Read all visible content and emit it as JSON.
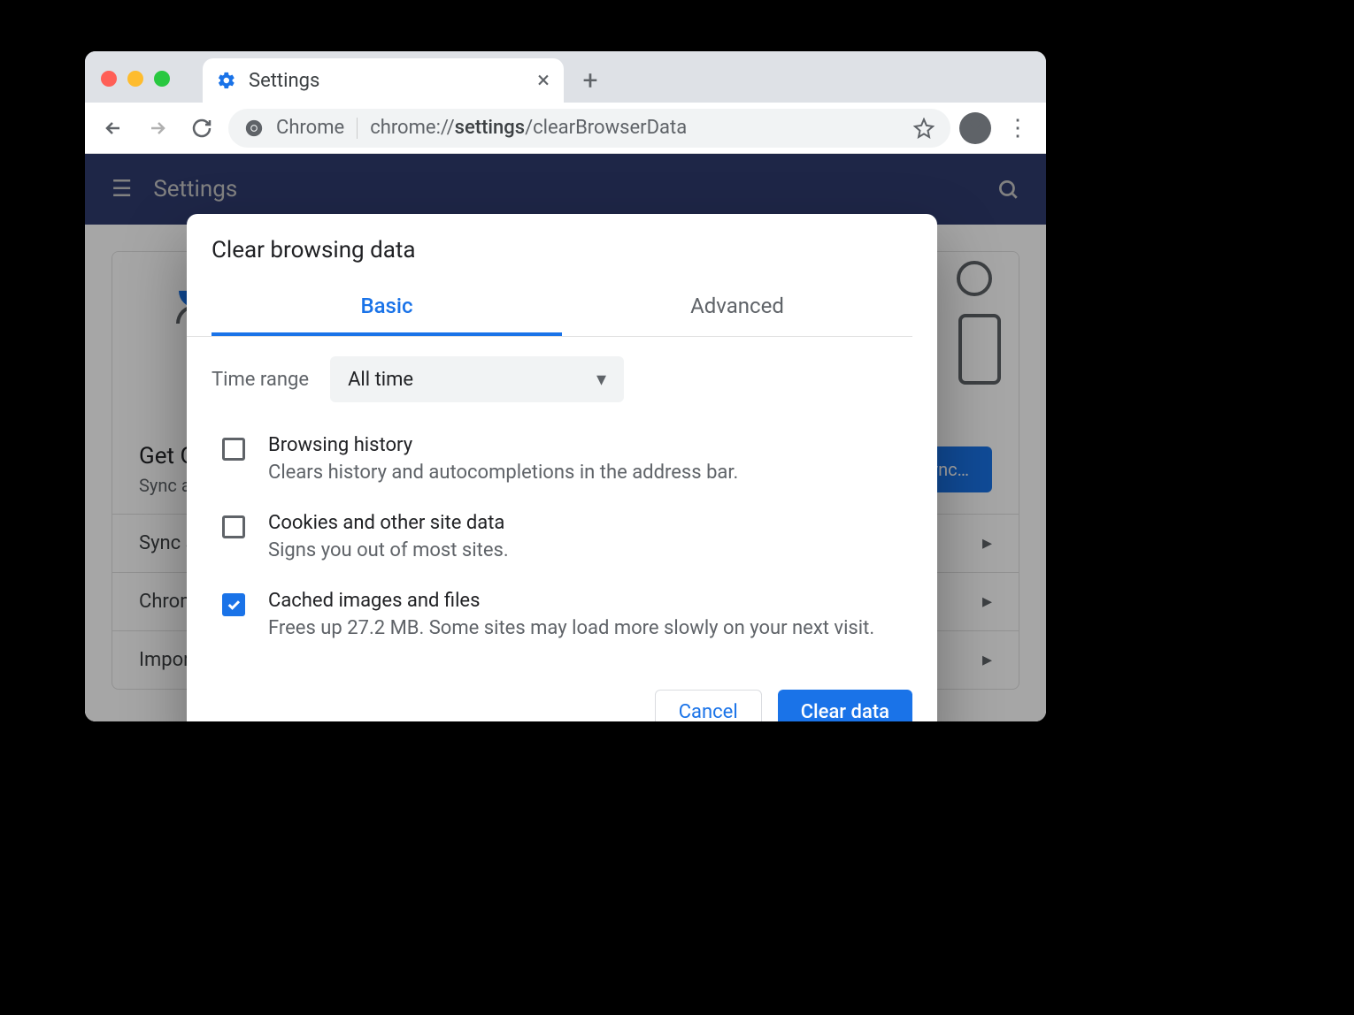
{
  "tab": {
    "title": "Settings"
  },
  "omnibox": {
    "secure_label": "Chrome",
    "url_prefix": "chrome://",
    "url_bold": "settings",
    "url_rest": "/clearBrowserData"
  },
  "app_bar": {
    "title": "Settings"
  },
  "settings_panel": {
    "heading": "Get Google smarts in Chrome",
    "subheading": "Sync and personalize Chrome across your devices",
    "turn_on_label": "Turn on sync…",
    "rows": [
      "Sync and Google services",
      "Chrome name and picture",
      "Import bookmarks and settings"
    ]
  },
  "dialog": {
    "title": "Clear browsing data",
    "tabs": {
      "basic": "Basic",
      "advanced": "Advanced"
    },
    "time_range_label": "Time range",
    "time_range_value": "All time",
    "options": [
      {
        "title": "Browsing history",
        "desc": "Clears history and autocompletions in the address bar.",
        "checked": false
      },
      {
        "title": "Cookies and other site data",
        "desc": "Signs you out of most sites.",
        "checked": false
      },
      {
        "title": "Cached images and files",
        "desc": "Frees up 27.2 MB. Some sites may load more slowly on your next visit.",
        "checked": true
      }
    ],
    "cancel": "Cancel",
    "confirm": "Clear data"
  }
}
